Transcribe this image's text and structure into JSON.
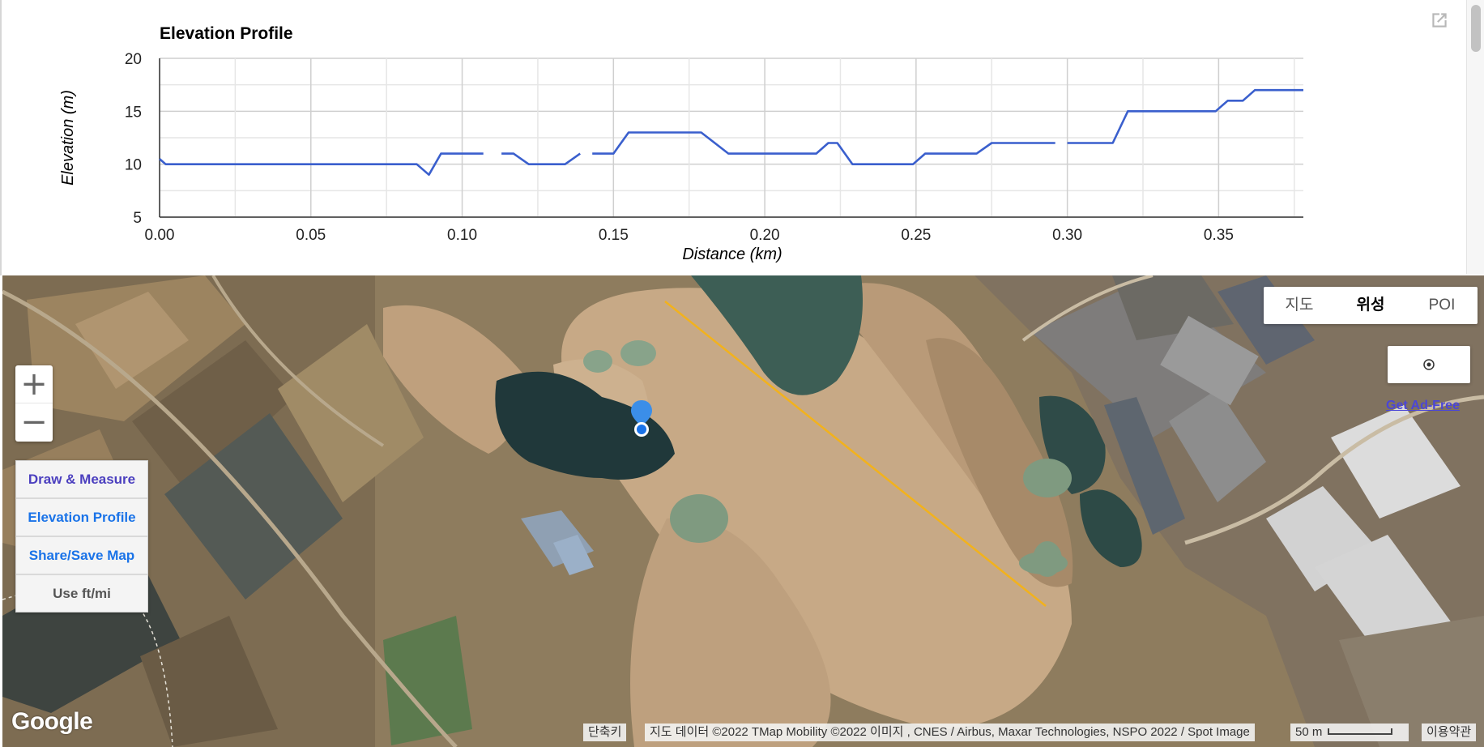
{
  "chart": {
    "title": "Elevation Profile",
    "external_link_icon": "external-link-icon"
  },
  "chart_data": {
    "type": "line",
    "title": "Elevation Profile",
    "xlabel": "Distance (km)",
    "ylabel": "Elevation (m)",
    "xlim": [
      0,
      0.378
    ],
    "ylim": [
      5,
      20
    ],
    "x_ticks": [
      "0.00",
      "0.05",
      "0.10",
      "0.15",
      "0.20",
      "0.25",
      "0.30",
      "0.35"
    ],
    "y_ticks": [
      "5",
      "10",
      "15",
      "20"
    ],
    "grid": true,
    "series_color": "#3a5fcd",
    "segments": [
      [
        [
          0,
          10.5
        ],
        [
          0.002,
          10
        ],
        [
          0.085,
          10
        ],
        [
          0.089,
          9
        ],
        [
          0.093,
          11
        ],
        [
          0.107,
          11
        ]
      ],
      [
        [
          0.113,
          11
        ],
        [
          0.117,
          11
        ],
        [
          0.122,
          10
        ],
        [
          0.134,
          10
        ],
        [
          0.139,
          11
        ]
      ],
      [
        [
          0.143,
          11
        ],
        [
          0.15,
          11
        ],
        [
          0.155,
          13
        ],
        [
          0.179,
          13
        ],
        [
          0.188,
          11
        ],
        [
          0.217,
          11
        ],
        [
          0.221,
          12
        ],
        [
          0.224,
          12
        ],
        [
          0.229,
          10
        ],
        [
          0.249,
          10
        ],
        [
          0.253,
          11
        ],
        [
          0.27,
          11
        ],
        [
          0.275,
          12
        ],
        [
          0.296,
          12
        ]
      ],
      [
        [
          0.3,
          12
        ],
        [
          0.315,
          12
        ],
        [
          0.32,
          15
        ],
        [
          0.349,
          15
        ],
        [
          0.353,
          16
        ],
        [
          0.358,
          16
        ],
        [
          0.362,
          17
        ],
        [
          0.378,
          17
        ]
      ]
    ]
  },
  "map": {
    "zoom_in": "+",
    "zoom_out": "−",
    "menu": {
      "draw": "Draw & Measure",
      "elevation": "Elevation Profile",
      "share": "Share/Save Map",
      "units": "Use ft/mi"
    },
    "map_types": {
      "map": "지도",
      "satellite": "위성",
      "poi": "POI"
    },
    "selected_map_type": "위성",
    "ad_free": "Get Ad-Free",
    "logo": "Google",
    "attribution": {
      "shortcuts": "단축키",
      "data": "지도 데이터 ©2022 TMap Mobility ©2022 이미지 , CNES / Airbus, Maxar Technologies, NSPO 2022 / Spot Image",
      "scale": "50 m",
      "terms": "이용약관"
    },
    "route_color": "#f2b21c",
    "marker_color": "#1a73e8"
  }
}
